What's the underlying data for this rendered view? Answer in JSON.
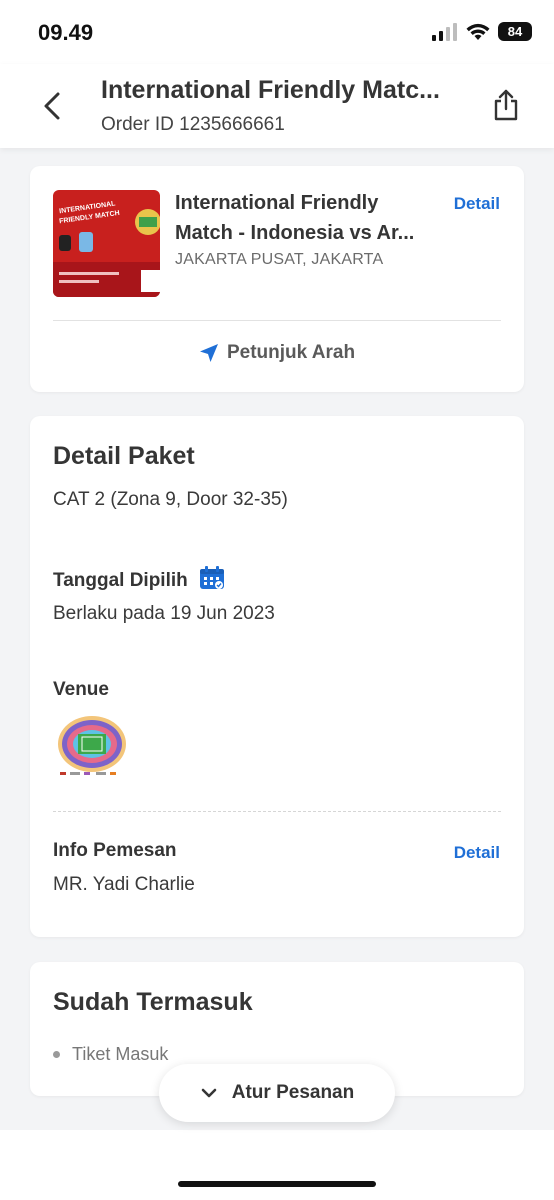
{
  "status_bar": {
    "time": "09.49",
    "battery": "84"
  },
  "header": {
    "title": "International Friendly Matc...",
    "order_id": "Order ID 1235666661"
  },
  "event_card": {
    "title_line1": "International Friendly",
    "title_line2": "Match - Indonesia vs Ar...",
    "location": "JAKARTA PUSAT, JAKARTA",
    "detail_label": "Detail",
    "directions_label": "Petunjuk Arah",
    "thumb_text": "INTERNATIONAL FRIENDLY MATCH"
  },
  "package": {
    "title": "Detail Paket",
    "category": "CAT 2 (Zona 9, Door 32-35)",
    "date_label": "Tanggal Dipilih",
    "date_value": "Berlaku pada 19 Jun 2023",
    "venue_label": "Venue",
    "booker_label": "Info Pemesan",
    "booker_name": "MR. Yadi Charlie",
    "detail_label": "Detail"
  },
  "included": {
    "title": "Sudah Termasuk",
    "items": [
      "Tiket Masuk"
    ]
  },
  "floating_button": {
    "label": "Atur Pesanan"
  },
  "colors": {
    "accent": "#1f6fd6",
    "thumb_red": "#c8201e",
    "background": "#f3f4f6"
  }
}
